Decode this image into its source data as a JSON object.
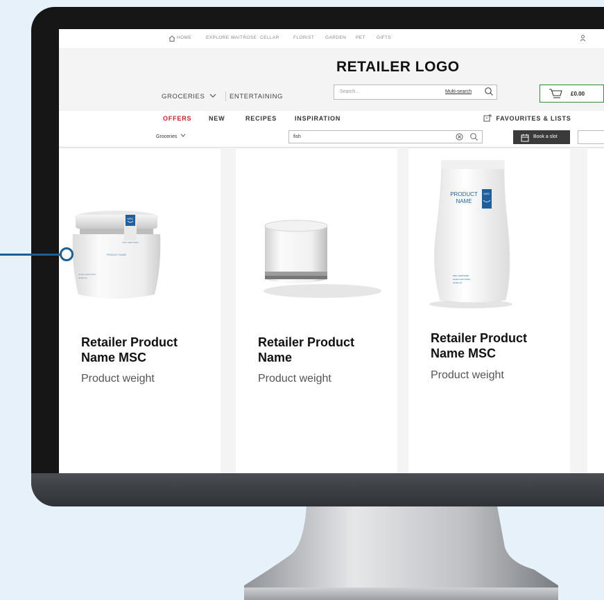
{
  "top_nav": {
    "items": [
      "HOME",
      "EXPLORE WAITROSE",
      "CELLAR",
      "FLORIST",
      "GARDEN",
      "PET",
      "GIFTS"
    ]
  },
  "logo": "RETAILER LOGO",
  "header": {
    "groceries_label": "GROCERIES",
    "entertaining_label": "ENTERTAINING",
    "search_placeholder": "Search...",
    "multisearch_label": "Multi-search",
    "basket_total": "£0.00"
  },
  "main_menu": {
    "items": [
      "OFFERS",
      "NEW",
      "RECIPES",
      "INSPIRATION"
    ],
    "favourites_label": "FAVOURITES & LISTS"
  },
  "toolbar": {
    "category_select": "Groceries",
    "search_value": "fish",
    "book_slot_label": "Book a slot"
  },
  "products": [
    {
      "name_line1": "Retailer Product",
      "name_line2": "Name MSC",
      "weight": "Product weight",
      "label_text": "PRODUCT NAME",
      "badge": "MSC"
    },
    {
      "name_line1": "Retailer Product",
      "name_line2": "Name",
      "weight": "Product weight"
    },
    {
      "name_line1": "Retailer Product",
      "name_line2": "Name MSC",
      "weight": "Product weight",
      "label_text_1": "PRODUCT",
      "label_text_2": "NAME",
      "badge": "MSC"
    }
  ],
  "colors": {
    "offers": "#d11a2a",
    "basket_border": "#2e8b3a",
    "callout": "#1d5f93",
    "background": "#e6f1f9"
  }
}
